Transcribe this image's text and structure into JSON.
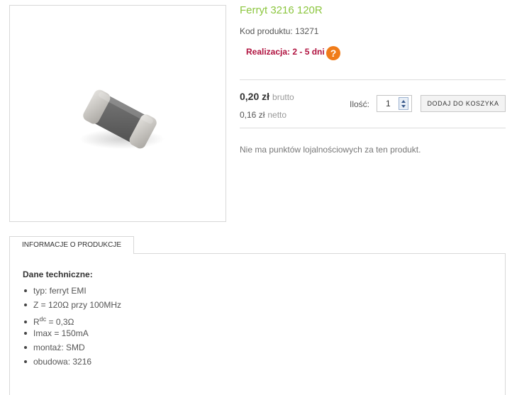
{
  "product": {
    "title": "Ferryt 3216 120R",
    "code_label": "Kod produktu:",
    "code_value": "13271",
    "realization": "Realizacja: 2 - 5 dni",
    "help_icon": "question-mark-icon",
    "image_alt": "Ferryt 3216 120R"
  },
  "pricing": {
    "brutto_value": "0,20 zł",
    "brutto_label": "brutto",
    "netto_value": "0,16 zł",
    "netto_label": "netto"
  },
  "cart": {
    "qty_label": "Ilość:",
    "qty_value": "1",
    "add_button": "DODAJ DO KOSZYKA"
  },
  "loyalty_text": "Nie ma punktów lojalnościowych za ten produkt.",
  "tabs": {
    "info_label": "INFORMACJE O PRODUKCJE"
  },
  "tech": {
    "heading": "Dane techniczne:",
    "items": [
      "typ: ferryt EMI",
      "Z = 120Ω przy 100MHz",
      "R",
      "dc",
      "= 0,3Ω",
      "Imax = 150mA",
      "montaż: SMD",
      "obudowa: 3216"
    ]
  },
  "colors": {
    "title": "#8cc63f",
    "realization": "#b0123f",
    "help_icon": "#f07c1a"
  }
}
